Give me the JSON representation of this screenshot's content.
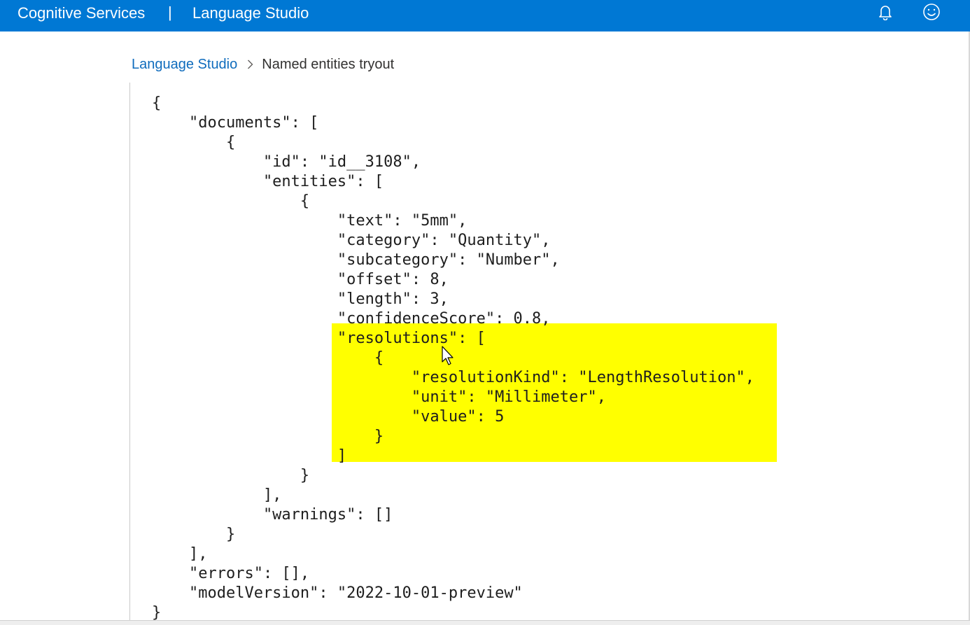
{
  "topbar": {
    "brand": "Cognitive Services",
    "separator": "|",
    "product": "Language Studio",
    "icons": [
      "bell-icon",
      "smiley-icon"
    ]
  },
  "breadcrumb": {
    "link": "Language Studio",
    "current": "Named entities tryout"
  },
  "json_view": {
    "lines": [
      "{",
      "    \"documents\": [",
      "        {",
      "            \"id\": \"id__3108\",",
      "            \"entities\": [",
      "                {",
      "                    \"text\": \"5mm\",",
      "                    \"category\": \"Quantity\",",
      "                    \"subcategory\": \"Number\",",
      "                    \"offset\": 8,",
      "                    \"length\": 3,",
      "                    \"confidenceScore\": 0.8,",
      "                    \"resolutions\": [",
      "                        {",
      "                            \"resolutionKind\": \"LengthResolution\",",
      "                            \"unit\": \"Millimeter\",",
      "                            \"value\": 5",
      "                        }",
      "                    ]",
      "                }",
      "            ],",
      "            \"warnings\": []",
      "        }",
      "    ],",
      "    \"errors\": [],",
      "    \"modelVersion\": \"2022-10-01-preview\"",
      "}"
    ]
  },
  "colors": {
    "header_bg": "#0078d4",
    "link": "#0f6cbd",
    "highlight": "#ffff00"
  }
}
